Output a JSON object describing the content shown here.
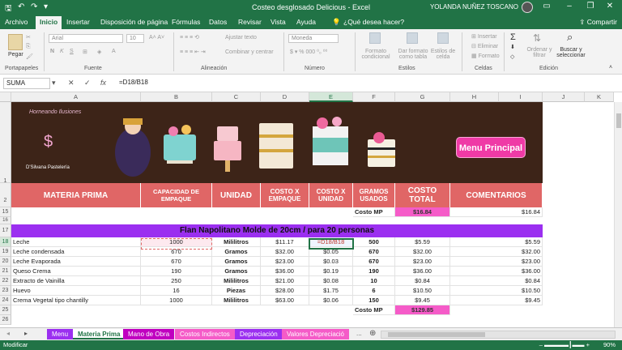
{
  "title_bar": {
    "document_title": "Costeo desglosado Delicious  -  Excel",
    "user_name": "YOLANDA NUÑEZ TOSCANO"
  },
  "ribbon_tabs": [
    "Archivo",
    "Inicio",
    "Insertar",
    "Disposición de página",
    "Fórmulas",
    "Datos",
    "Revisar",
    "Vista",
    "Ayuda"
  ],
  "tell_me": "¿Qué desea hacer?",
  "share_label": "Compartir",
  "ribbon": {
    "paste": "Pegar",
    "clipboard": "Portapapeles",
    "font_group": "Fuente",
    "font_name": "Arial",
    "font_size": "10",
    "alignment_group": "Alineación",
    "wrap_text": "Ajustar texto",
    "merge_center": "Combinar y centrar",
    "number_group": "Número",
    "number_format": "Moneda",
    "styles_group": "Estilos",
    "conditional_format": "Formato condicional",
    "format_as_table": "Dar formato como tabla",
    "cell_styles": "Estilos de celda",
    "cells_group": "Celdas",
    "insert": "Insertar",
    "delete": "Eliminar",
    "format": "Formato",
    "editing_group": "Edición",
    "sort_filter": "Ordenar y filtrar",
    "find_select": "Buscar y seleccionar"
  },
  "formula_bar": {
    "name_box": "SUMA",
    "formula": "=D18/B18"
  },
  "columns": [
    "A",
    "B",
    "C",
    "D",
    "E",
    "F",
    "G",
    "H",
    "I",
    "J",
    "K"
  ],
  "banner": {
    "logo_text": "Horneando Ilusiones",
    "logo_sub": "D'Silvana Pastelería",
    "menu_button": "Menu Principal"
  },
  "header_row": {
    "row_number": "2",
    "materia_prima": "MATERIA PRIMA",
    "capacidad": "CAPACIDAD DE EMPAQUE",
    "unidad": "UNIDAD",
    "costo_empaque": "COSTO X EMPAQUE",
    "costo_unidad": "COSTO X UNIDAD",
    "gramos": "GRAMOS USADOS",
    "costo_total": "COSTO TOTAL",
    "comentarios": "COMENTARIOS"
  },
  "row15": {
    "row_number": "15",
    "label": "Costo MP",
    "total": "$16.84",
    "comment": "$16.84"
  },
  "row17": {
    "row_number": "17",
    "title": "Flan Napolitano Molde de 20cm / para 20 personas"
  },
  "row16": {
    "row_number": "16"
  },
  "items": [
    {
      "row": "18",
      "name": "Leche",
      "capacidad": "1000",
      "unidad": "Mililitros",
      "costo_empaque": "$11.17",
      "costo_unidad": "=D18/B18",
      "gramos": "500",
      "costo_total": "$5.59",
      "comentario": "$5.59"
    },
    {
      "row": "19",
      "name": "Leche condensada",
      "capacidad": "670",
      "unidad": "Gramos",
      "costo_empaque": "$32.00",
      "costo_unidad": "$0.05",
      "gramos": "670",
      "costo_total": "$32.00",
      "comentario": "$32.00"
    },
    {
      "row": "20",
      "name": "Leche Evaporada",
      "capacidad": "670",
      "unidad": "Gramos",
      "costo_empaque": "$23.00",
      "costo_unidad": "$0.03",
      "gramos": "670",
      "costo_total": "$23.00",
      "comentario": "$23.00"
    },
    {
      "row": "21",
      "name": "Queso Crema",
      "capacidad": "190",
      "unidad": "Gramos",
      "costo_empaque": "$36.00",
      "costo_unidad": "$0.19",
      "gramos": "190",
      "costo_total": "$36.00",
      "comentario": "$36.00"
    },
    {
      "row": "22",
      "name": "Extracto de Vainilla",
      "capacidad": "250",
      "unidad": "Mililitros",
      "costo_empaque": "$21.00",
      "costo_unidad": "$0.08",
      "gramos": "10",
      "costo_total": "$0.84",
      "comentario": "$0.84"
    },
    {
      "row": "23",
      "name": "Huevo",
      "capacidad": "16",
      "unidad": "Piezas",
      "costo_empaque": "$28.00",
      "costo_unidad": "$1.75",
      "gramos": "6",
      "costo_total": "$10.50",
      "comentario": "$10.50"
    },
    {
      "row": "24",
      "name": "Crema Vegetal tipo chantilly",
      "capacidad": "1000",
      "unidad": "Mililitros",
      "costo_empaque": "$63.00",
      "costo_unidad": "$0.06",
      "gramos": "150",
      "costo_total": "$9.45",
      "comentario": "$9.45"
    }
  ],
  "row25": {
    "row_number": "25",
    "label": "Costo MP",
    "total": "$129.85"
  },
  "row26": {
    "row_number": "26"
  },
  "row1": {
    "row_number": "1"
  },
  "sheet_tabs": [
    {
      "label": "Menu",
      "color": "#9b2ff0"
    },
    {
      "label": "Materia Prima",
      "color": "#ffffff"
    },
    {
      "label": "Mano de Obra",
      "color": "#c000c0"
    },
    {
      "label": "Costos Indirectos",
      "color": "#f55bc8"
    },
    {
      "label": "Depreciación",
      "color": "#9b2ff0"
    },
    {
      "label": "Valores Depreciació",
      "color": "#f55bc8"
    }
  ],
  "sheet_more": "...",
  "status": {
    "mode": "Modificar",
    "zoom": "90%"
  },
  "colors": {
    "excel_green": "#217346",
    "header_red": "#e06666",
    "pink": "#f55bc8",
    "purple": "#9b2ff0"
  }
}
